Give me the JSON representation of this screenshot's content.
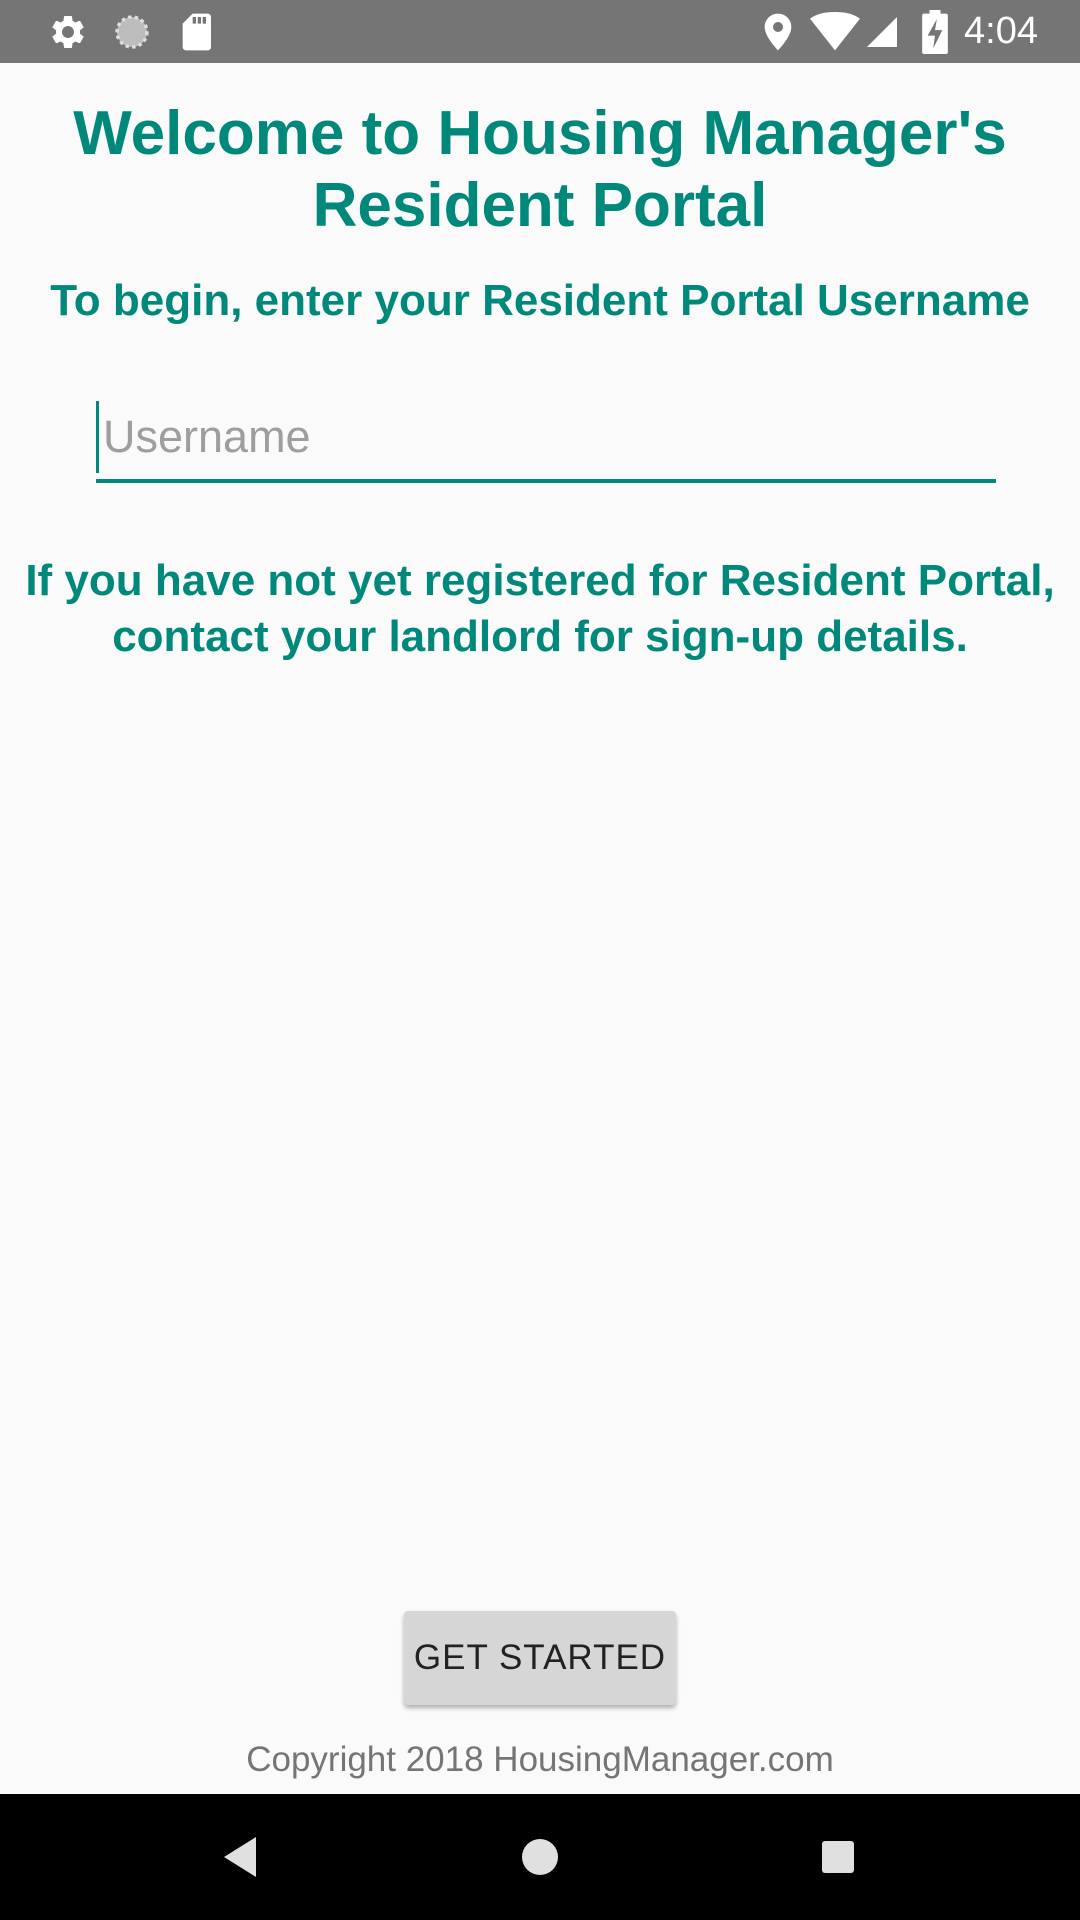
{
  "status_bar": {
    "time": "4:04",
    "icons": [
      "gear-icon",
      "sync-icon",
      "sd-card-icon",
      "location-icon",
      "wifi-icon",
      "signal-icon",
      "battery-charging-icon"
    ]
  },
  "main": {
    "title": "Welcome to Housing Manager's Resident Portal",
    "subtitle": "To begin, enter your Resident Portal Username",
    "username_placeholder": "Username",
    "username_value": "",
    "info_text": "If you have not yet registered for Resident Portal, contact your landlord for sign-up details.",
    "button_label": "GET STARTED",
    "copyright": "Copyright 2018 HousingManager.com"
  },
  "nav_bar": {
    "icons": [
      "back-icon",
      "home-icon",
      "recents-icon"
    ]
  },
  "colors": {
    "accent": "#00897b",
    "status_bar": "#757575",
    "nav_bar": "#000000",
    "button": "#d6d6d6"
  }
}
